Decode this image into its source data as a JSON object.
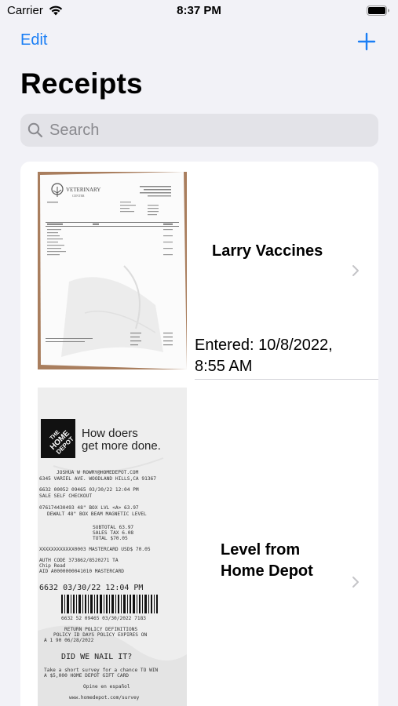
{
  "status_bar": {
    "carrier": "Carrier",
    "time": "8:37 PM"
  },
  "nav": {
    "edit_label": "Edit",
    "add_icon": "plus-icon",
    "title": "Receipts"
  },
  "search": {
    "placeholder": "Search"
  },
  "receipts": [
    {
      "title": "Larry Vaccines",
      "entered": "Entered: 10/8/2022, 8:55 AM",
      "entered_line1": "Entered: 10/8/2022,",
      "entered_line2": "8:55 AM",
      "thumbnail": {
        "logo_text": "VETERINARY",
        "logo_sub": "CENTER"
      }
    },
    {
      "title": "Level from Home Depot",
      "title_line1": "Level from",
      "title_line2": "Home Depot",
      "thumbnail": {
        "logo_text": "THE HOME DEPOT",
        "slogan_line1": "How doers",
        "slogan_line2": "get more done.",
        "lines": [
          "JOSHUA W ROWRY@HOMEDEPOT.COM",
          "6345 VARIEL AVE. WOODLAND HILLS,CA 91367",
          "6632 00052 09465 03/30/22 12:04 PM",
          "SALE SELF CHECKOUT",
          "076174430493 48\" BOX LVL <A> 63.97",
          "DEWALT 48\" BOX BEAM MAGNETIC LEVEL",
          "SUBTOTAL 63.97",
          "SALES TAX 6.08",
          "TOTAL $70.05",
          "XXXXXXXXXXXX0003 MASTERCARD USD$ 70.05",
          "AUTH CODE 373862/8520271 TA",
          "Chip Read",
          "AID A0000000041010 MASTERCARD",
          "6632 03/30/22 12:04 PM",
          "6632 52 09465 03/30/2022 7183",
          "RETURN POLICY DEFINITIONS",
          "POLICY ID DAYS POLICY EXPIRES ON",
          "A 1 90 06/28/2022",
          "DID WE NAIL IT?",
          "Take a short survey for a chance TO WIN",
          "A $5,000 HOME DEPOT GIFT CARD",
          "Opine en español",
          "www.homedepot.com/survey"
        ]
      }
    }
  ],
  "colors": {
    "accent": "#1a7ef5",
    "background": "#f2f2f7",
    "card": "#ffffff",
    "search_fill": "#e3e3e8",
    "placeholder": "#8a8a8f"
  }
}
